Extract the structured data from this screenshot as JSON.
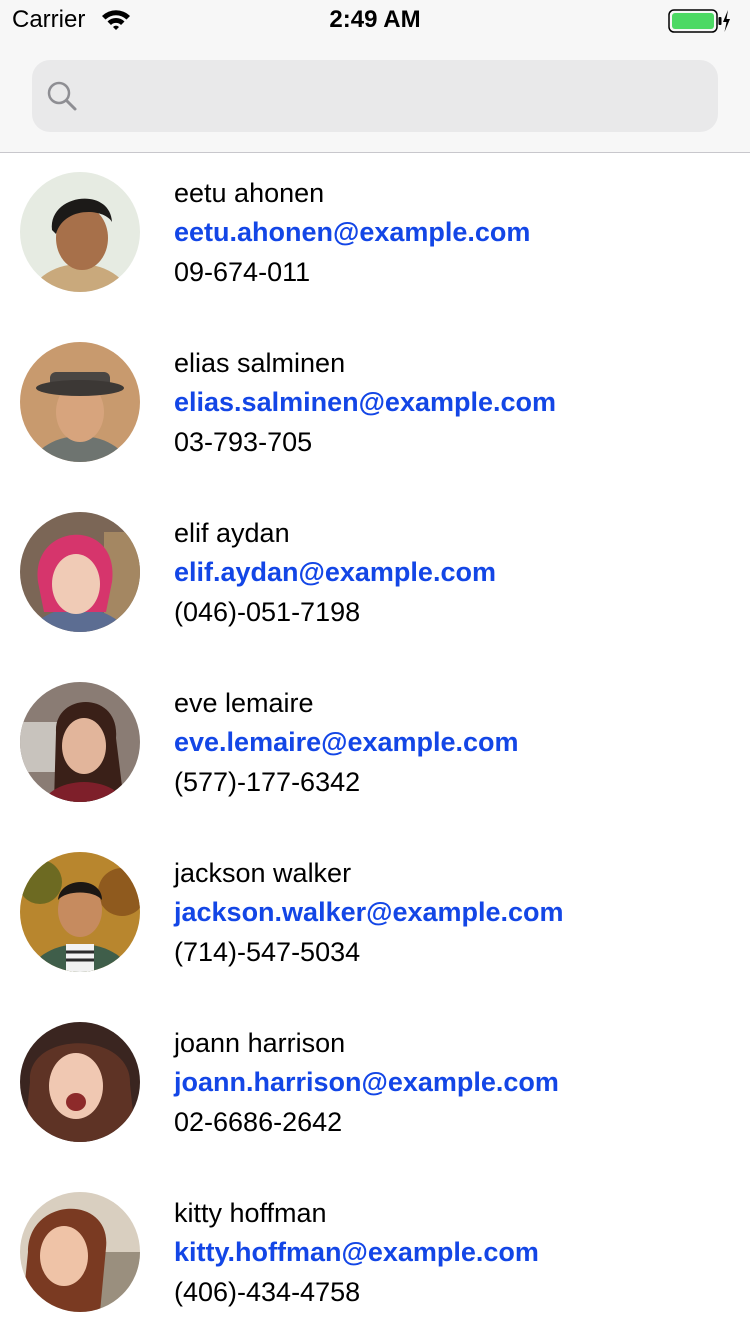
{
  "status_bar": {
    "carrier": "Carrier",
    "time": "2:49 AM",
    "icons": [
      "wifi-icon",
      "battery-icon",
      "charging-bolt-icon"
    ],
    "battery_color": "#4cd964"
  },
  "search": {
    "placeholder": "",
    "value": "",
    "icon": "search-icon"
  },
  "colors": {
    "email_link": "#1346e6",
    "header_background": "#f7f7f7",
    "search_background": "#e9e9ea"
  },
  "contacts": [
    {
      "name": "eetu ahonen",
      "email": "eetu.ahonen@example.com",
      "phone": "09-674-011",
      "avatar": "avatar-photo"
    },
    {
      "name": "elias salminen",
      "email": "elias.salminen@example.com",
      "phone": "03-793-705",
      "avatar": "avatar-photo"
    },
    {
      "name": "elif aydan",
      "email": "elif.aydan@example.com",
      "phone": "(046)-051-7198",
      "avatar": "avatar-photo"
    },
    {
      "name": "eve lemaire",
      "email": "eve.lemaire@example.com",
      "phone": "(577)-177-6342",
      "avatar": "avatar-photo"
    },
    {
      "name": "jackson walker",
      "email": "jackson.walker@example.com",
      "phone": "(714)-547-5034",
      "avatar": "avatar-photo"
    },
    {
      "name": "joann harrison",
      "email": "joann.harrison@example.com",
      "phone": "02-6686-2642",
      "avatar": "avatar-photo"
    },
    {
      "name": "kitty hoffman",
      "email": "kitty.hoffman@example.com",
      "phone": "(406)-434-4758",
      "avatar": "avatar-photo"
    }
  ]
}
